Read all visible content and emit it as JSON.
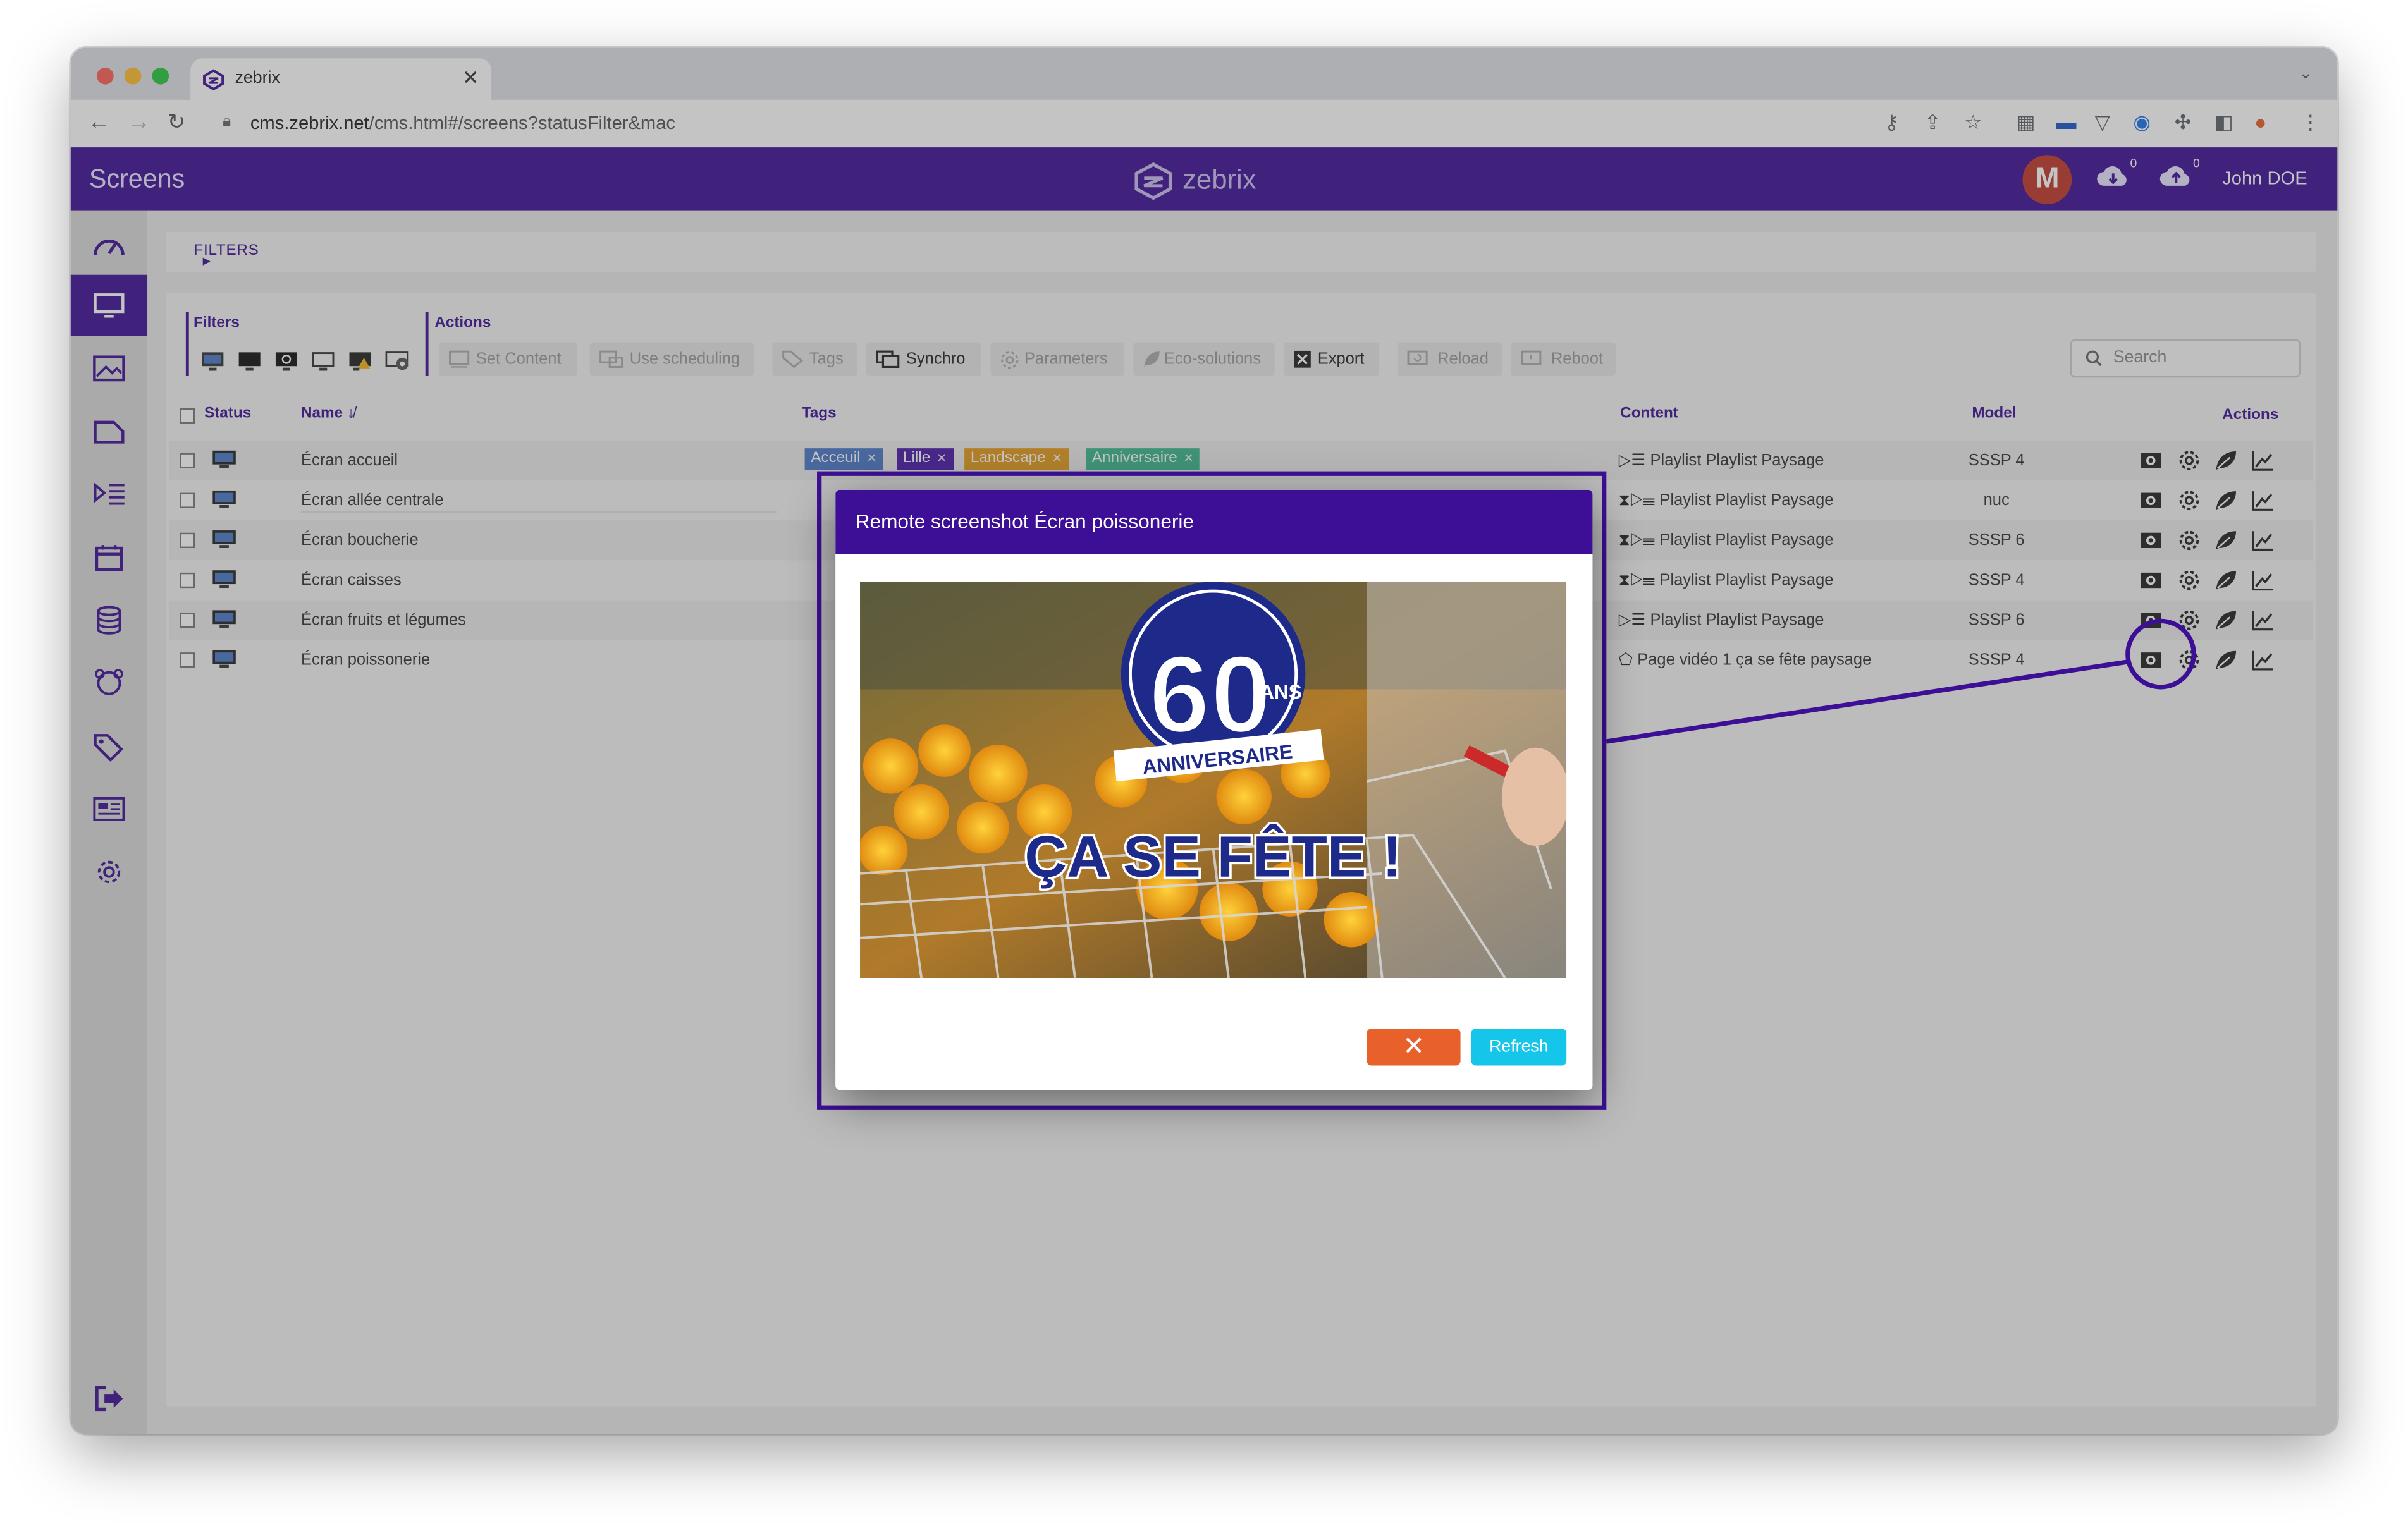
{
  "browser": {
    "tab_title": "zebrix",
    "url_domain": "cms.zebrix.net",
    "url_path": "/cms.html#/screens?statusFilter&mac"
  },
  "header": {
    "page_title": "Screens",
    "brand": "zebrix",
    "avatar_letter": "M",
    "download_count": "0",
    "upload_count": "0",
    "user_name": "John DOE"
  },
  "sidebar": {
    "items": [
      "dashboard-icon",
      "screens-icon",
      "media-icon",
      "folder-icon",
      "playlist-icon",
      "calendar-icon",
      "database-icon",
      "groups-icon",
      "tags-icon",
      "news-icon",
      "settings-icon"
    ],
    "logout": "logout-icon"
  },
  "filters_bar": {
    "label": "FILTERS"
  },
  "toolbar": {
    "filters_label": "Filters",
    "actions_label": "Actions",
    "actions": [
      {
        "label": "Set Content",
        "enabled": false
      },
      {
        "label": "Use scheduling",
        "enabled": false
      },
      {
        "label": "Tags",
        "enabled": false
      },
      {
        "label": "Synchro",
        "enabled": true
      },
      {
        "label": "Parameters",
        "enabled": false
      },
      {
        "label": "Eco-solutions",
        "enabled": false
      },
      {
        "label": "Export",
        "enabled": true
      },
      {
        "label": "Reload",
        "enabled": false
      },
      {
        "label": "Reboot",
        "enabled": false
      }
    ],
    "search_placeholder": "Search"
  },
  "table": {
    "columns": {
      "status": "Status",
      "name": "Name",
      "tags": "Tags",
      "content": "Content",
      "model": "Model",
      "actions": "Actions"
    },
    "rows": [
      {
        "name": "Écran accueil",
        "content": "Playlist Playlist Paysage",
        "content_icon": "playlist",
        "model": "SSSP 4"
      },
      {
        "name": "Écran allée centrale",
        "content": "Playlist Playlist Paysage",
        "content_icon": "scheduled-playlist",
        "model": "nuc"
      },
      {
        "name": "Écran boucherie",
        "content": "Playlist Playlist Paysage",
        "content_icon": "scheduled-playlist",
        "model": "SSSP 6"
      },
      {
        "name": "Écran caisses",
        "content": "Playlist Playlist Paysage",
        "content_icon": "scheduled-playlist",
        "model": "SSSP 4"
      },
      {
        "name": "Écran fruits et légumes",
        "content": "Playlist Playlist Paysage",
        "content_icon": "playlist",
        "model": "SSSP 6"
      },
      {
        "name": "Écran poissonerie",
        "content": "Page vidéo 1 ça se fête paysage",
        "content_icon": "page",
        "model": "SSSP 4"
      }
    ],
    "first_row_tags": [
      {
        "label": "Acceuil",
        "color": "#4a78c8"
      },
      {
        "label": "Lille",
        "color": "#4a1aa8"
      },
      {
        "label": "Landscape",
        "color": "#e39a1c"
      },
      {
        "label": "Anniversaire",
        "color": "#3bb68c"
      }
    ]
  },
  "modal": {
    "title": "Remote screenshot Écran poissonerie",
    "screenshot": {
      "badge_number": "60",
      "badge_suffix": "ANS",
      "badge_ribbon": "ANNIVERSAIRE",
      "headline": "ÇA SE FÊTE !"
    },
    "close_label": "✕",
    "refresh_label": "Refresh"
  },
  "colors": {
    "brand_purple": "#3d0f96",
    "close_orange": "#e8602a",
    "refresh_cyan": "#16c6ea"
  }
}
